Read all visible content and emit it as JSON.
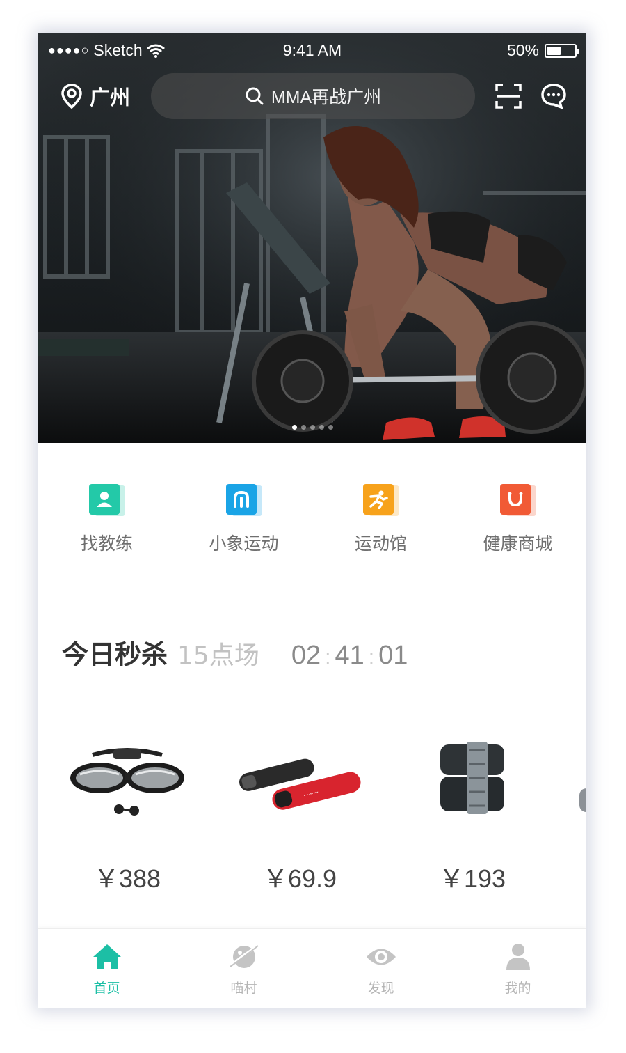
{
  "status_bar": {
    "carrier": "Sketch",
    "signal_dots": "●●●●○",
    "time": "9:41 AM",
    "battery": "50%",
    "battery_level": 0.5
  },
  "header": {
    "city": "广州",
    "search_text": "MMA再战广州"
  },
  "banner": {
    "pages": 5,
    "active_page": 0
  },
  "categories": [
    {
      "label": "找教练",
      "icon": "coach-icon",
      "color": "#23c9a8"
    },
    {
      "label": "小象运动",
      "icon": "elephant-sport-icon",
      "color": "#1aa4e6"
    },
    {
      "label": "运动馆",
      "icon": "gym-runner-icon",
      "color": "#f7a21b"
    },
    {
      "label": "健康商城",
      "icon": "shop-bag-icon",
      "color": "#f15a35"
    }
  ],
  "flash_sale": {
    "title": "今日秒杀",
    "session": "15点场",
    "hours": "02",
    "minutes": "41",
    "seconds": "01",
    "separator": ":"
  },
  "products": [
    {
      "name": "swim-goggles",
      "price": "￥388"
    },
    {
      "name": "barbell-pad",
      "price": "￥69.9"
    },
    {
      "name": "ankle-weights",
      "price": "￥193"
    }
  ],
  "tabs": [
    {
      "label": "首页",
      "icon": "home-icon",
      "active": true
    },
    {
      "label": "喵村",
      "icon": "planet-icon",
      "active": false
    },
    {
      "label": "发现",
      "icon": "eye-icon",
      "active": false
    },
    {
      "label": "我的",
      "icon": "user-icon",
      "active": false
    }
  ],
  "colors": {
    "accent": "#1cbfa5",
    "inactive": "#c4c4c4"
  }
}
